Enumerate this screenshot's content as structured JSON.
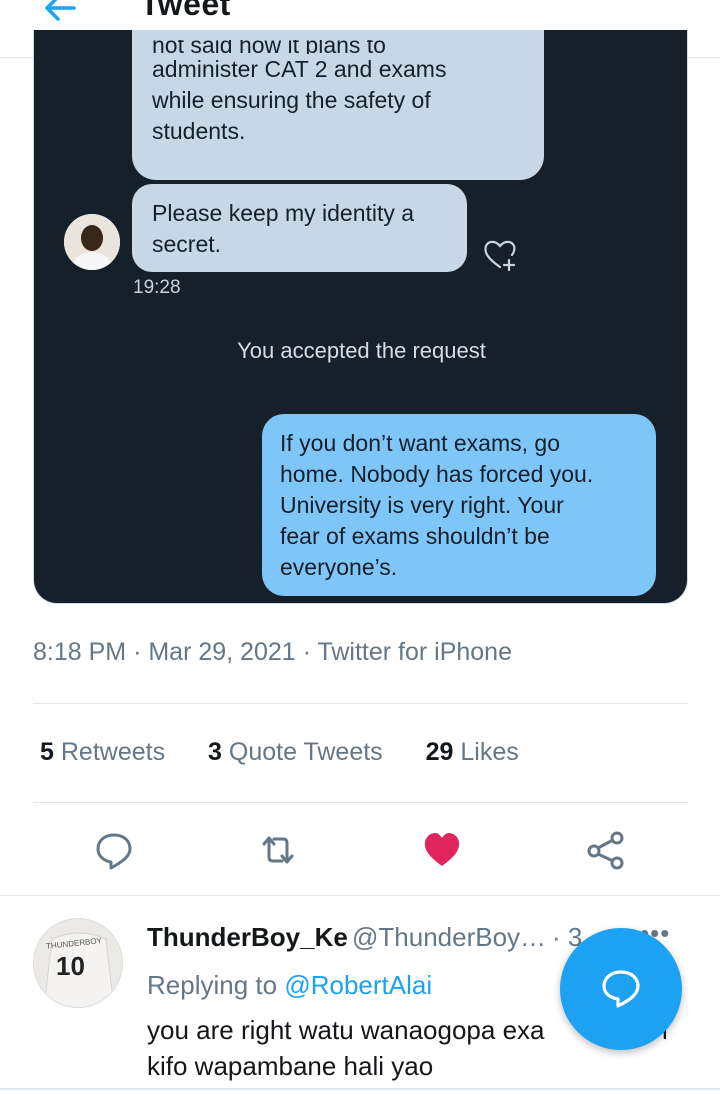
{
  "header": {
    "title": "Tweet",
    "back_icon": "arrow-left-icon"
  },
  "embedded_image": {
    "bubble1_cut_line": "not said how it plans to",
    "bubble1_lines": [
      "administer CAT 2 and exams",
      "while ensuring the safety of",
      "students."
    ],
    "bubble2_lines": [
      "Please keep my identity a",
      "secret."
    ],
    "timestamp": "19:28",
    "system_message": "You accepted the request",
    "bubble3_lines": [
      "If you don’t want exams, go",
      "home. Nobody has forced you.",
      "University is very right. Your",
      "fear of exams shouldn’t be",
      "everyone’s."
    ]
  },
  "tweet_meta": {
    "time": "8:18 PM",
    "date": "Mar 29, 2021",
    "source": "Twitter for iPhone",
    "separator": "·"
  },
  "stats": {
    "retweets_count": "5",
    "retweets_label": "Retweets",
    "quotes_count": "3",
    "quotes_label": "Quote Tweets",
    "likes_count": "29",
    "likes_label": "Likes"
  },
  "actions": {
    "icons": [
      "reply-icon",
      "retweet-icon",
      "like-icon",
      "share-icon"
    ],
    "like_color": "#e0245e",
    "icon_color": "#657786"
  },
  "reply": {
    "name": "ThunderBoy_Ke",
    "handle": "@ThunderBoy…",
    "time_partial": "· 3",
    "more": "•••",
    "replying_prefix": "Replying to",
    "replying_to": "@RobertAlai",
    "text_line1": "you are right watu wanaogopa exa",
    "text_line1_end": "i",
    "text_line2": "kifo wapambane hali yao",
    "avatar_jersey_number": "10",
    "avatar_jersey_brand": "THUNDERBOY"
  },
  "fab": {
    "icon": "compose-reply-icon",
    "color": "#1da1f2"
  },
  "colors": {
    "accent": "#1da1f2",
    "dm_background": "#16202b",
    "sent_bubble": "#7ec6f7",
    "received_bubble": "#c7d7e5"
  }
}
